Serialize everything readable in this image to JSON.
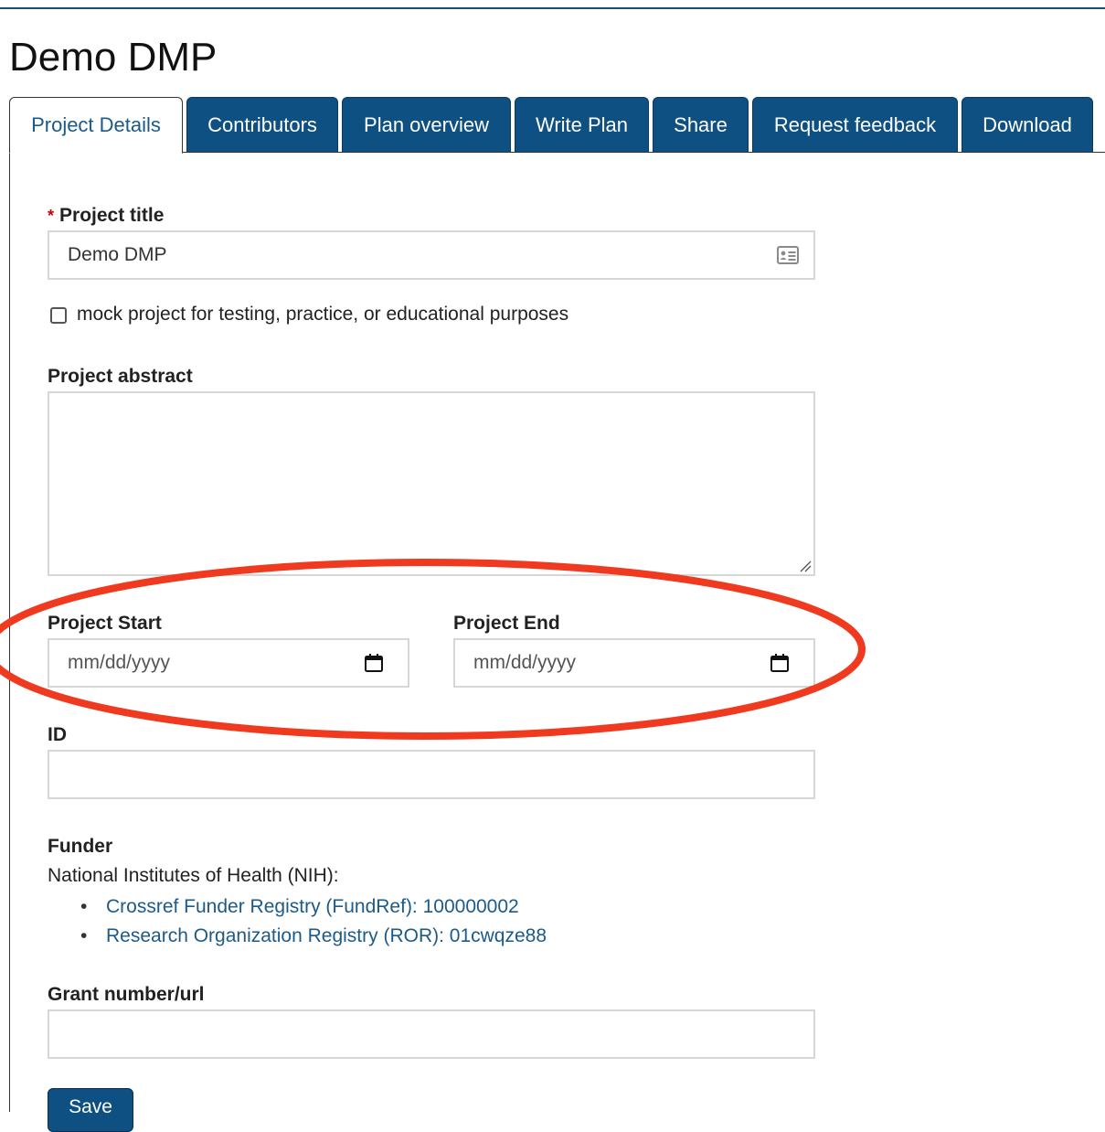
{
  "page": {
    "title": "Demo DMP"
  },
  "tabs": [
    {
      "label": "Project Details",
      "active": true
    },
    {
      "label": "Contributors"
    },
    {
      "label": "Plan overview"
    },
    {
      "label": "Write Plan"
    },
    {
      "label": "Share"
    },
    {
      "label": "Request feedback"
    },
    {
      "label": "Download"
    }
  ],
  "form": {
    "project_title": {
      "required_marker": "*",
      "label": "Project title",
      "value": "Demo DMP"
    },
    "mock_checkbox": {
      "label": "mock project for testing, practice, or educational purposes",
      "checked": false
    },
    "abstract": {
      "label": "Project abstract",
      "value": ""
    },
    "project_start": {
      "label": "Project Start",
      "placeholder": "mm/dd/yyyy"
    },
    "project_end": {
      "label": "Project End",
      "placeholder": "mm/dd/yyyy"
    },
    "id": {
      "label": "ID",
      "value": ""
    },
    "funder": {
      "label": "Funder",
      "name": "National Institutes of Health (NIH):",
      "links": [
        "Crossref Funder Registry (FundRef): 100000002",
        "Research Organization Registry (ROR): 01cwqze88"
      ]
    },
    "grant": {
      "label": "Grant number/url",
      "value": ""
    },
    "save_label": "Save"
  },
  "icons": {
    "title_field": "contact-card-icon",
    "start_date": "calendar-icon",
    "end_date": "calendar-icon",
    "textarea": "resize-handle-icon"
  },
  "colors": {
    "brand": "#0d5081",
    "link": "#1c5a8a",
    "required": "#cc0000",
    "annotation": "#f03a1f"
  }
}
